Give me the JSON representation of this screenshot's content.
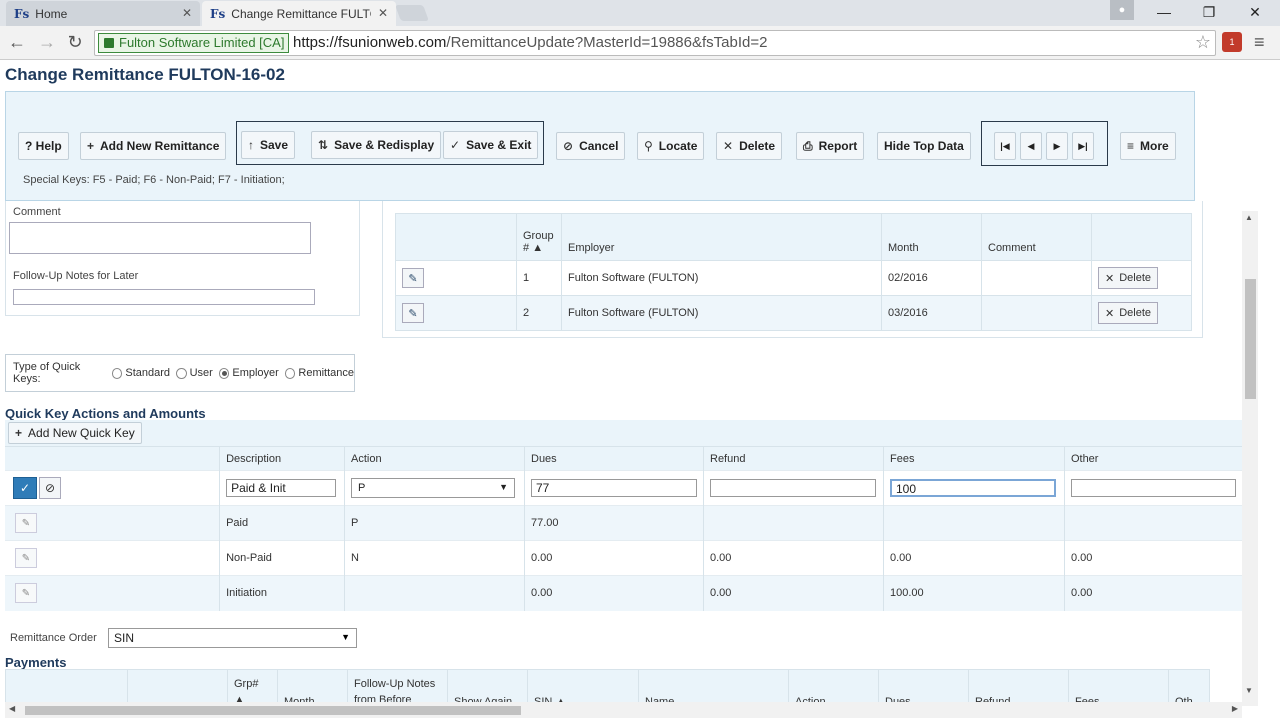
{
  "browser": {
    "tabs": [
      {
        "favicon": "Fs",
        "title": "Home"
      },
      {
        "favicon": "Fs",
        "title": "Change Remittance FULTC"
      }
    ],
    "ssl_label": "Fulton Software Limited [CA]",
    "url_host": "https://fsunionweb.com",
    "url_path": "/RemittanceUpdate?MasterId=19886&fsTabId=2",
    "extension_badge": "1"
  },
  "page": {
    "title": "Change Remittance FULTON-16-02"
  },
  "toolbar": {
    "help": "? Help",
    "add_new": "Add New Remittance",
    "save": "Save",
    "save_redisplay": "Save & Redisplay",
    "save_exit": "Save & Exit",
    "cancel": "Cancel",
    "locate": "Locate",
    "delete": "Delete",
    "report": "Report",
    "hide_top": "Hide Top Data",
    "more": "More",
    "special_keys": "Special Keys: F5 - Paid; F6 - Non-Paid; F7 - Initiation;"
  },
  "left": {
    "comment_label": "Comment",
    "followup_label": "Follow-Up Notes for Later"
  },
  "employers": {
    "headers": {
      "group": "Group",
      "hash": "#",
      "employer": "Employer",
      "month": "Month",
      "comment": "Comment"
    },
    "rows": [
      {
        "group": "1",
        "employer": "Fulton Software (FULTON)",
        "month": "02/2016",
        "comment": "",
        "delete": "Delete"
      },
      {
        "group": "2",
        "employer": "Fulton Software (FULTON)",
        "month": "03/2016",
        "comment": "",
        "delete": "Delete"
      }
    ]
  },
  "quick_keys_type": {
    "label": "Type of Quick Keys:",
    "options": [
      "Standard",
      "User",
      "Employer",
      "Remittance"
    ],
    "selected": "Employer"
  },
  "quick_actions": {
    "title": "Quick Key Actions and Amounts",
    "add_button": "Add New Quick Key",
    "headers": {
      "description": "Description",
      "action": "Action",
      "dues": "Dues",
      "refund": "Refund",
      "fees": "Fees",
      "other": "Other"
    },
    "edit_row": {
      "description": "Paid & Init",
      "action": "P",
      "dues": "77",
      "refund": "",
      "fees": "100",
      "other": ""
    },
    "rows": [
      {
        "description": "Paid",
        "action": "P",
        "dues": "77.00",
        "refund": "",
        "fees": "",
        "other": ""
      },
      {
        "description": "Non-Paid",
        "action": "N",
        "dues": "0.00",
        "refund": "0.00",
        "fees": "0.00",
        "other": "0.00"
      },
      {
        "description": "Initiation",
        "action": "",
        "dues": "0.00",
        "refund": "0.00",
        "fees": "100.00",
        "other": "0.00"
      }
    ]
  },
  "remittance_order": {
    "label": "Remittance Order",
    "value": "SIN"
  },
  "payments": {
    "title": "Payments",
    "headers": [
      "",
      "",
      "Grp# ▲",
      "Month",
      "Follow-Up Notes from Before",
      "Show Again",
      "SIN ▲",
      "Name",
      "Action",
      "Dues",
      "Refund",
      "Fees",
      "Oth"
    ]
  }
}
